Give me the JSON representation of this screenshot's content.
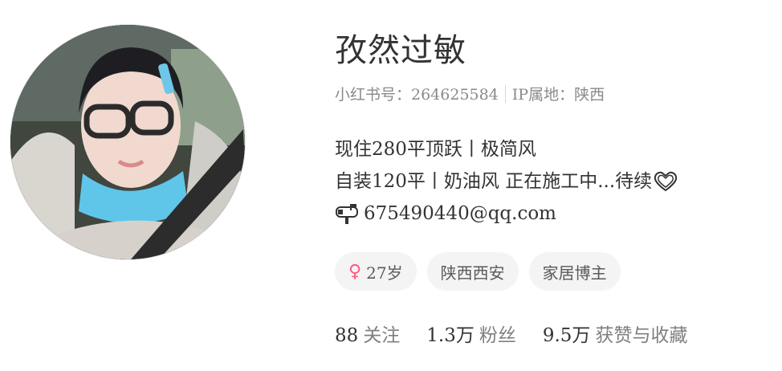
{
  "profile": {
    "nickname": "孜然过敏",
    "red_id_label": "小红书号：264625584",
    "ip_label": "IP属地：陕西",
    "bio_lines": [
      "现住280平顶跃丨极简风",
      "自装120平丨奶油风 正在施工中...待续",
      "675490440@qq.com"
    ],
    "icons": {
      "bio_heart": "heart-outline-icon",
      "bio_mail": "mailbox-icon",
      "gender": "female-icon"
    },
    "tags": [
      {
        "label": "27岁"
      },
      {
        "label": "陕西西安"
      },
      {
        "label": "家居博主"
      }
    ],
    "stats": [
      {
        "value": "88",
        "label": "关注"
      },
      {
        "value": "1.3万",
        "label": "粉丝"
      },
      {
        "value": "9.5万",
        "label": "获赞与收藏"
      }
    ],
    "colors": {
      "gender_female": "#ff5a7e",
      "tag_bg": "#f4f4f4",
      "meta_text": "#8a8a8a"
    }
  }
}
